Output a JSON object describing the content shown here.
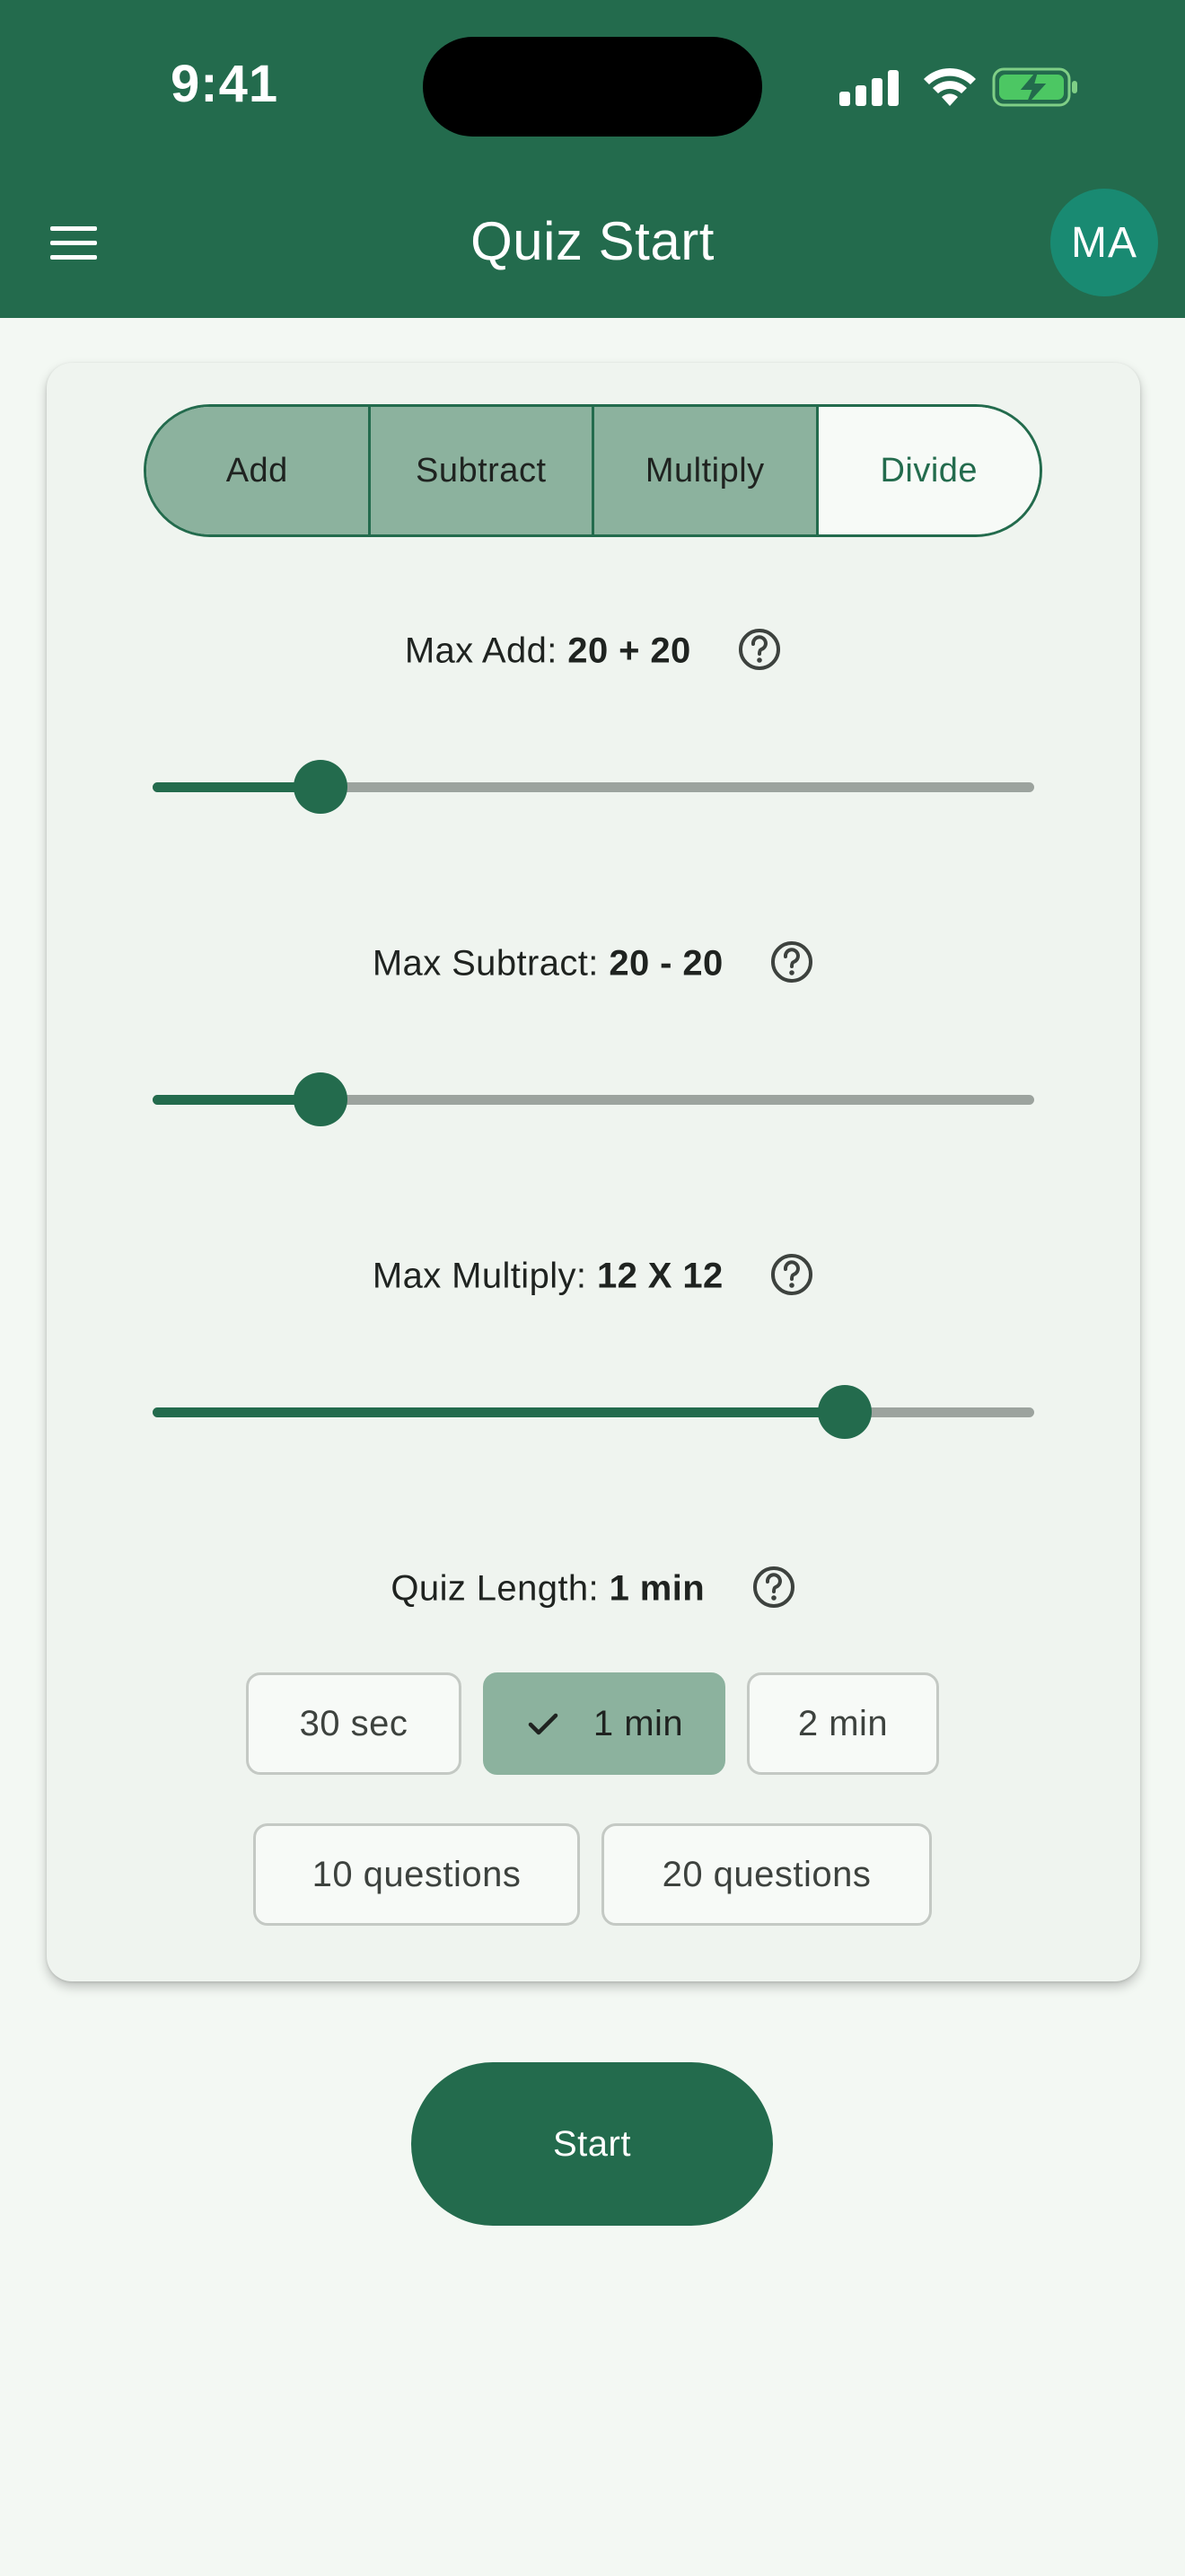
{
  "status_bar": {
    "time": "9:41",
    "icons": [
      "signal-icon",
      "wifi-icon",
      "battery-charging-icon"
    ]
  },
  "app_bar": {
    "menu_icon": "hamburger-menu-icon",
    "title": "Quiz Start",
    "avatar_initials": "MA"
  },
  "colors": {
    "primary": "#236b4d",
    "primary_light": "#8cb29e",
    "avatar": "#198a72",
    "background": "#f3f8f3",
    "card": "#eff4ef"
  },
  "operations": {
    "items": [
      {
        "label": "Add",
        "selected": true
      },
      {
        "label": "Subtract",
        "selected": true
      },
      {
        "label": "Multiply",
        "selected": true
      },
      {
        "label": "Divide",
        "selected": false
      }
    ]
  },
  "settings": {
    "add": {
      "label": "Max Add: ",
      "value": "20 + 20",
      "slider_fraction": 0.19
    },
    "subtract": {
      "label": "Max Subtract: ",
      "value": "20 - 20",
      "slider_fraction": 0.19
    },
    "multiply": {
      "label": "Max Multiply: ",
      "value": "12 X 12",
      "slider_fraction": 0.785
    },
    "quiz_length": {
      "label": "Quiz Length: ",
      "value": "1 min"
    }
  },
  "quiz_length_options": {
    "row1": [
      {
        "label": "30 sec",
        "selected": false
      },
      {
        "label": "1 min",
        "selected": true
      },
      {
        "label": "2 min",
        "selected": false
      }
    ],
    "row2": [
      {
        "label": "10 questions",
        "selected": false
      },
      {
        "label": "20 questions",
        "selected": false
      }
    ]
  },
  "start_button": {
    "label": "Start"
  }
}
